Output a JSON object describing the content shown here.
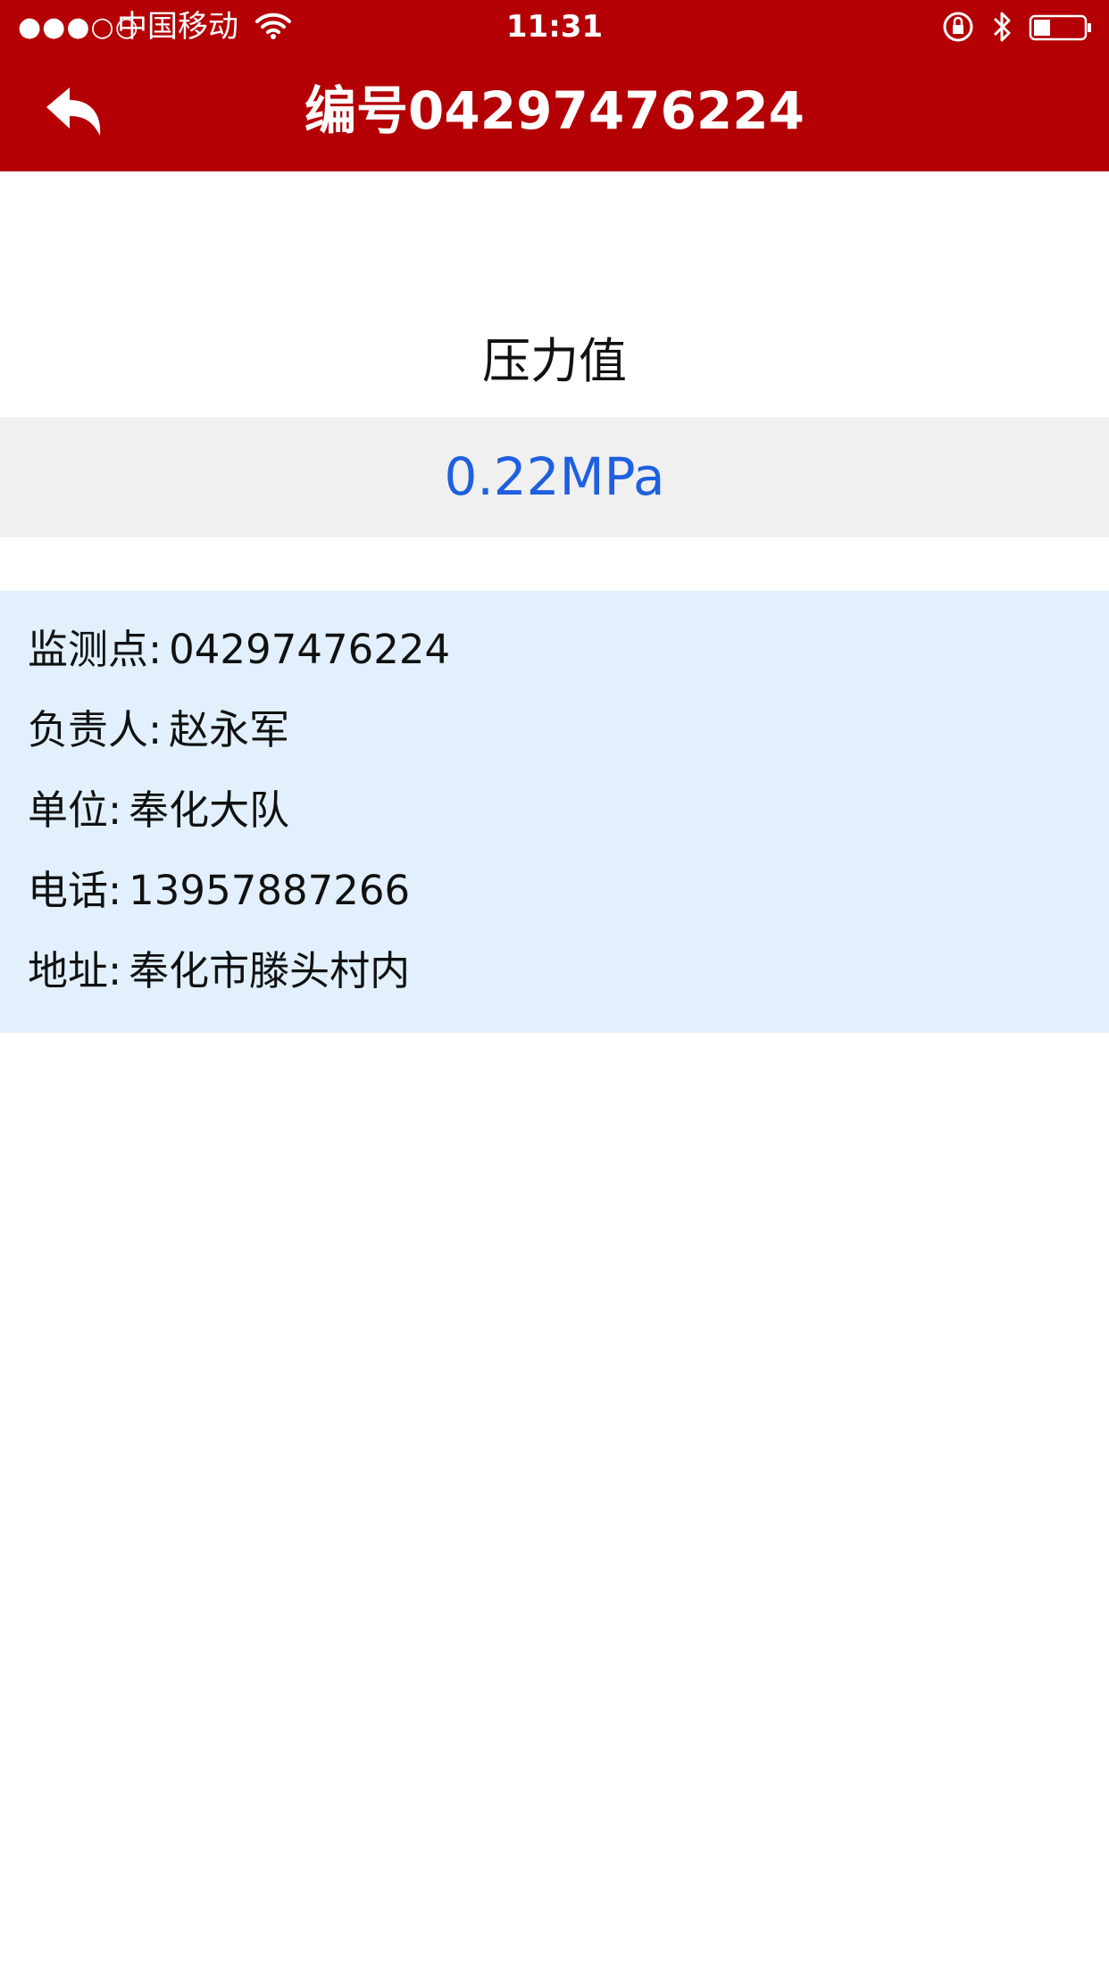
{
  "status_bar": {
    "signal": "●●●○○",
    "carrier": "中国移动",
    "time": "11:31",
    "icons": [
      "wifi-icon",
      "orientation-lock-icon",
      "bluetooth-icon",
      "battery-icon"
    ]
  },
  "nav": {
    "back_icon": "back-arrow-icon",
    "title": "编号04297476224"
  },
  "pressure": {
    "label": "压力值",
    "value": "0.22MPa"
  },
  "info": {
    "rows": [
      {
        "label": "监测点:",
        "value": "04297476224"
      },
      {
        "label": "负责人:",
        "value": "赵永军"
      },
      {
        "label": "单位:",
        "value": "奉化大队"
      },
      {
        "label": "电话:",
        "value": "13957887266"
      },
      {
        "label": "地址:",
        "value": "奉化市滕头村内"
      }
    ]
  },
  "colors": {
    "header_bg": "#b40004",
    "pressure_value": "#1f5fe0",
    "pressure_box_bg": "#f0f0f0",
    "info_panel_bg": "#e1f0fc"
  }
}
